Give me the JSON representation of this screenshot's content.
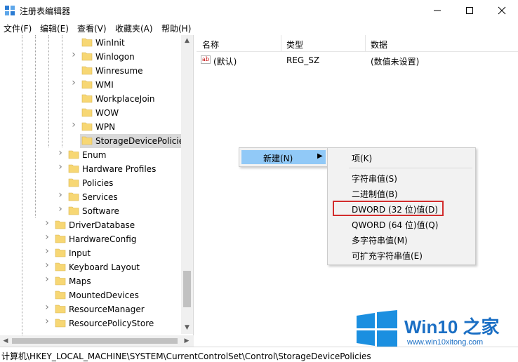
{
  "window": {
    "title": "注册表编辑器",
    "app_icon": "regedit-icon",
    "controls": [
      "minimize-icon",
      "maximize-icon",
      "close-icon"
    ]
  },
  "menubar": {
    "items": [
      "文件(F)",
      "编辑(E)",
      "查看(V)",
      "收藏夹(A)",
      "帮助(H)"
    ]
  },
  "tree": {
    "items": [
      {
        "label": "WinInit",
        "expander": false
      },
      {
        "label": "Winlogon",
        "expander": true
      },
      {
        "label": "Winresume",
        "expander": false
      },
      {
        "label": "WMI",
        "expander": true
      },
      {
        "label": "WorkplaceJoin",
        "expander": false
      },
      {
        "label": "WOW",
        "expander": false
      },
      {
        "label": "WPN",
        "expander": true
      },
      {
        "label": "StorageDevicePolicie",
        "expander": false,
        "selected": true
      },
      {
        "label": "Enum",
        "expander": true
      },
      {
        "label": "Hardware Profiles",
        "expander": true
      },
      {
        "label": "Policies",
        "expander": false
      },
      {
        "label": "Services",
        "expander": true
      },
      {
        "label": "Software",
        "expander": true
      },
      {
        "label": "DriverDatabase",
        "expander": true
      },
      {
        "label": "HardwareConfig",
        "expander": true
      },
      {
        "label": "Input",
        "expander": true
      },
      {
        "label": "Keyboard Layout",
        "expander": true
      },
      {
        "label": "Maps",
        "expander": true
      },
      {
        "label": "MountedDevices",
        "expander": false
      },
      {
        "label": "ResourceManager",
        "expander": true
      },
      {
        "label": "ResourcePolicyStore",
        "expander": true
      }
    ]
  },
  "list": {
    "columns": [
      "名称",
      "类型",
      "数据"
    ],
    "rows": [
      {
        "name": "(默认)",
        "type": "REG_SZ",
        "data": "(数值未设置)",
        "icon": "string-value-icon"
      }
    ]
  },
  "context_menu": {
    "new_label": "新建(N)",
    "submenu": {
      "key_item": "项(K)",
      "value_items": [
        "字符串值(S)",
        "二进制值(B)",
        "DWORD (32 位)值(D)",
        "QWORD (64 位)值(Q)",
        "多字符串值(M)",
        "可扩充字符串值(E)"
      ],
      "highlighted": "DWORD (32 位)值(D)"
    }
  },
  "statusbar": {
    "path": "计算机\\HKEY_LOCAL_MACHINE\\SYSTEM\\CurrentControlSet\\Control\\StorageDevicePolicies"
  },
  "watermark": {
    "brand": "Win10 之家",
    "url": "www.win10xitong.com"
  },
  "colors": {
    "folder": "#f7d774",
    "menu_highlight": "#91c9f7",
    "selection": "#d9d9d9",
    "highlight_box": "#d22d2d",
    "watermark": "#1b6fc4"
  }
}
